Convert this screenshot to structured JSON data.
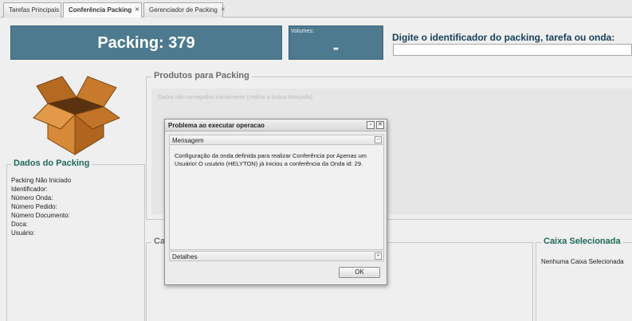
{
  "tabs": [
    {
      "label": "Tarefas Principais",
      "closable": false,
      "active": false
    },
    {
      "label": "Conferência Packing",
      "closable": true,
      "active": true
    },
    {
      "label": "Gerenciador de Packing",
      "closable": true,
      "active": false
    }
  ],
  "header": {
    "packing_label": "Packing: 379",
    "volumes_label": "Volumes:",
    "volumes_value": "-",
    "search_label": "Digite o identificador do packing, tarefa ou onda:",
    "search_value": ""
  },
  "dados_packing": {
    "title": "Dados do Packing",
    "lines": [
      "Packing Não Iniciado",
      "Identificador:",
      "Número Onda:",
      "Número Pedido:",
      "Número Documento:",
      "Doca:",
      "Usuário:"
    ]
  },
  "produtos": {
    "title": "Produtos para Packing",
    "empty_text": "Dados não carregados inicialmente (realize a busca desejada)."
  },
  "caixas": {
    "title": "Ca"
  },
  "caixa_selecionada": {
    "title": "Caixa Selecionada",
    "text": "Nenhuma Caixa Selecionada"
  },
  "dialog": {
    "title": "Problema ao executar operacao",
    "message_header": "Mensagem",
    "message": "Configuração da onda definida para realizar Conferência por Apenas um Usuário! O usuário (HELYTON) já iniciou a conferência da Onda id: 29.",
    "details_header": "Detalhes",
    "ok_label": "OK"
  },
  "colors": {
    "header_blue": "#4d7a8f",
    "legend_green": "#1f6a58",
    "search_label_navy": "#173f5a"
  },
  "icons": {
    "box": "open-cardboard-box-icon",
    "tab_close": "close-icon",
    "dialog_maximize": "maximize-icon",
    "dialog_close": "close-icon",
    "collapse": "collapse-icon",
    "expand": "expand-icon"
  }
}
